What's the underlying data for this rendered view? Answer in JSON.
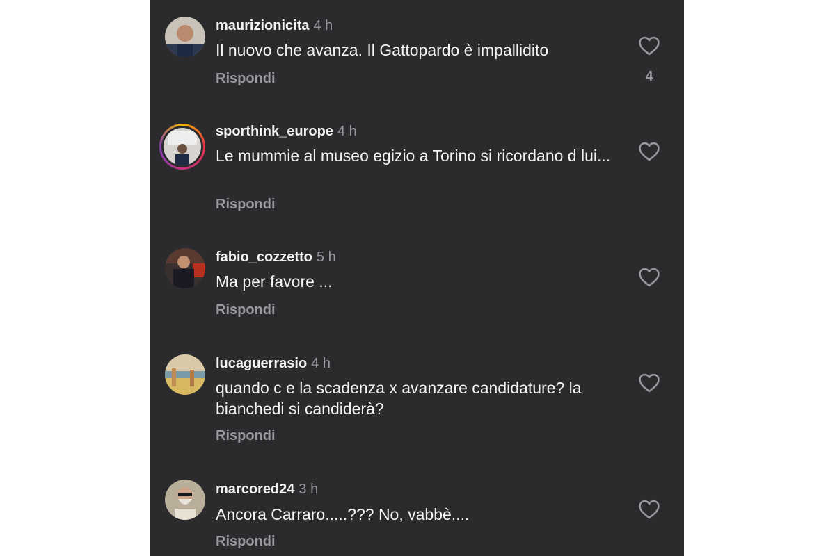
{
  "comments": [
    {
      "username": "maurizionicita",
      "time": "4 h",
      "text": "Il nuovo che avanza. Il Gattopardo è impallidito",
      "reply_label": "Rispondi",
      "like_count": "4",
      "avatar_icon": "avatar-photo"
    },
    {
      "username": "sporthink_europe",
      "time": "4 h",
      "text": "Le mummie al museo egizio a Torino si ricordano d lui...",
      "reply_label": "Rispondi",
      "avatar_icon": "avatar-photo-story-ring"
    },
    {
      "username": "fabio_cozzetto",
      "time": "5 h",
      "text": "Ma per favore ...",
      "reply_label": "Rispondi",
      "avatar_icon": "avatar-photo"
    },
    {
      "username": "lucaguerrasio",
      "time": "4 h",
      "text": "quando c e la scadenza x avanzare candidature? la bianchedi si candiderà?",
      "reply_label": "Rispondi",
      "avatar_icon": "avatar-photo"
    },
    {
      "username": "marcored24",
      "time": "3 h",
      "text": "Ancora Carraro.....??? No, vabbè....",
      "reply_label": "Rispondi",
      "avatar_icon": "avatar-photo"
    }
  ],
  "colors": {
    "background": "#2b2b2e",
    "text_primary": "#f4f4f4",
    "text_secondary": "#9a9a9e",
    "story_ring": "#c13584"
  }
}
